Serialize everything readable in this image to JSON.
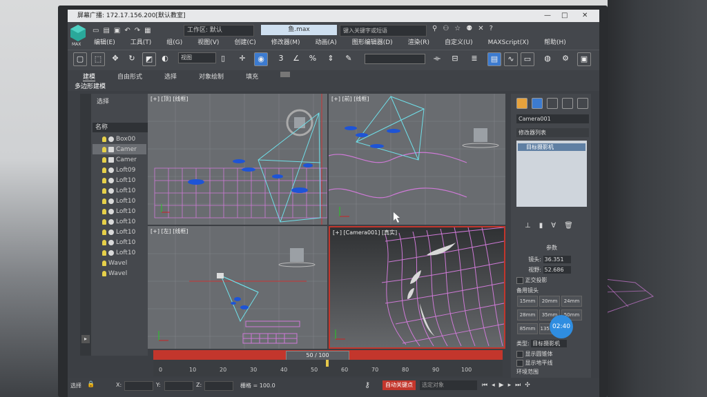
{
  "window": {
    "title": "屏幕广播: 172.17.156.200[默认教室]"
  },
  "quick_access": {
    "workspace_label": "工作区: 默认",
    "file_name": "鱼.max",
    "search_placeholder": "键入关键字或短语"
  },
  "menu": {
    "items": [
      "编辑(E)",
      "工具(T)",
      "组(G)",
      "视图(V)",
      "创建(C)",
      "修改器(M)",
      "动画(A)",
      "图形编辑器(D)",
      "渲染(R)",
      "自定义(U)",
      "MAXScript(X)",
      "帮助(H)"
    ]
  },
  "toolbar": {
    "view_dropdown": "视图"
  },
  "ribbon": {
    "tabs": [
      "建模",
      "自由形式",
      "选择",
      "对象绘制",
      "填充"
    ],
    "sub_label": "多边形建模"
  },
  "scene_explorer": {
    "header": "选择",
    "column_name": "名称",
    "items": [
      "Box00",
      "Camer",
      "Camer",
      "Loft09",
      "Loft10",
      "Loft10",
      "Loft10",
      "Loft10",
      "Loft10",
      "Loft10",
      "Loft10",
      "Loft10",
      "Wavel",
      "Wavel"
    ]
  },
  "viewports": {
    "top": "[+] [顶] [线框]",
    "front": "[+] [前] [线框]",
    "left": "[+] [左] [线框]",
    "camera": "[+] [Camera001] [真实]"
  },
  "command_panel": {
    "object_name": "Camera001",
    "modifier_list": "修改器列表",
    "stack_item": "目标摄影机",
    "params_title": "参数",
    "lens_label": "镜头:",
    "lens_value": "36.351",
    "fov_label": "视野:",
    "fov_value": "52.686",
    "ortho_label": "正交投影",
    "stock_lens_label": "备用镜头",
    "stock_lenses": [
      "15mm",
      "20mm",
      "24mm",
      "28mm",
      "35mm",
      "50mm",
      "85mm",
      "135mm"
    ],
    "type_label": "类型:",
    "type_value": "目标摄影机",
    "show_cone": "显示圆锥体",
    "show_horizon": "显示地平线",
    "env_range": "环境范围"
  },
  "timeline": {
    "frame_display": "50 / 100",
    "ticks": [
      "0",
      "10",
      "20",
      "30",
      "40",
      "50",
      "60",
      "70",
      "80",
      "90",
      "100"
    ]
  },
  "status": {
    "select_label": "选择",
    "x_label": "X:",
    "y_label": "Y:",
    "z_label": "Z:",
    "grid_label": "栅格 = 100.0",
    "auto_key": "自动关键点",
    "selection_sets": "选定对象"
  },
  "overlay": {
    "timer": "02:40"
  },
  "colors": {
    "autokey_red": "#c3362c",
    "wire_pink": "#d07ad8",
    "camera_cyan": "#6fe0ea",
    "fish_blue": "#1e54d6"
  }
}
